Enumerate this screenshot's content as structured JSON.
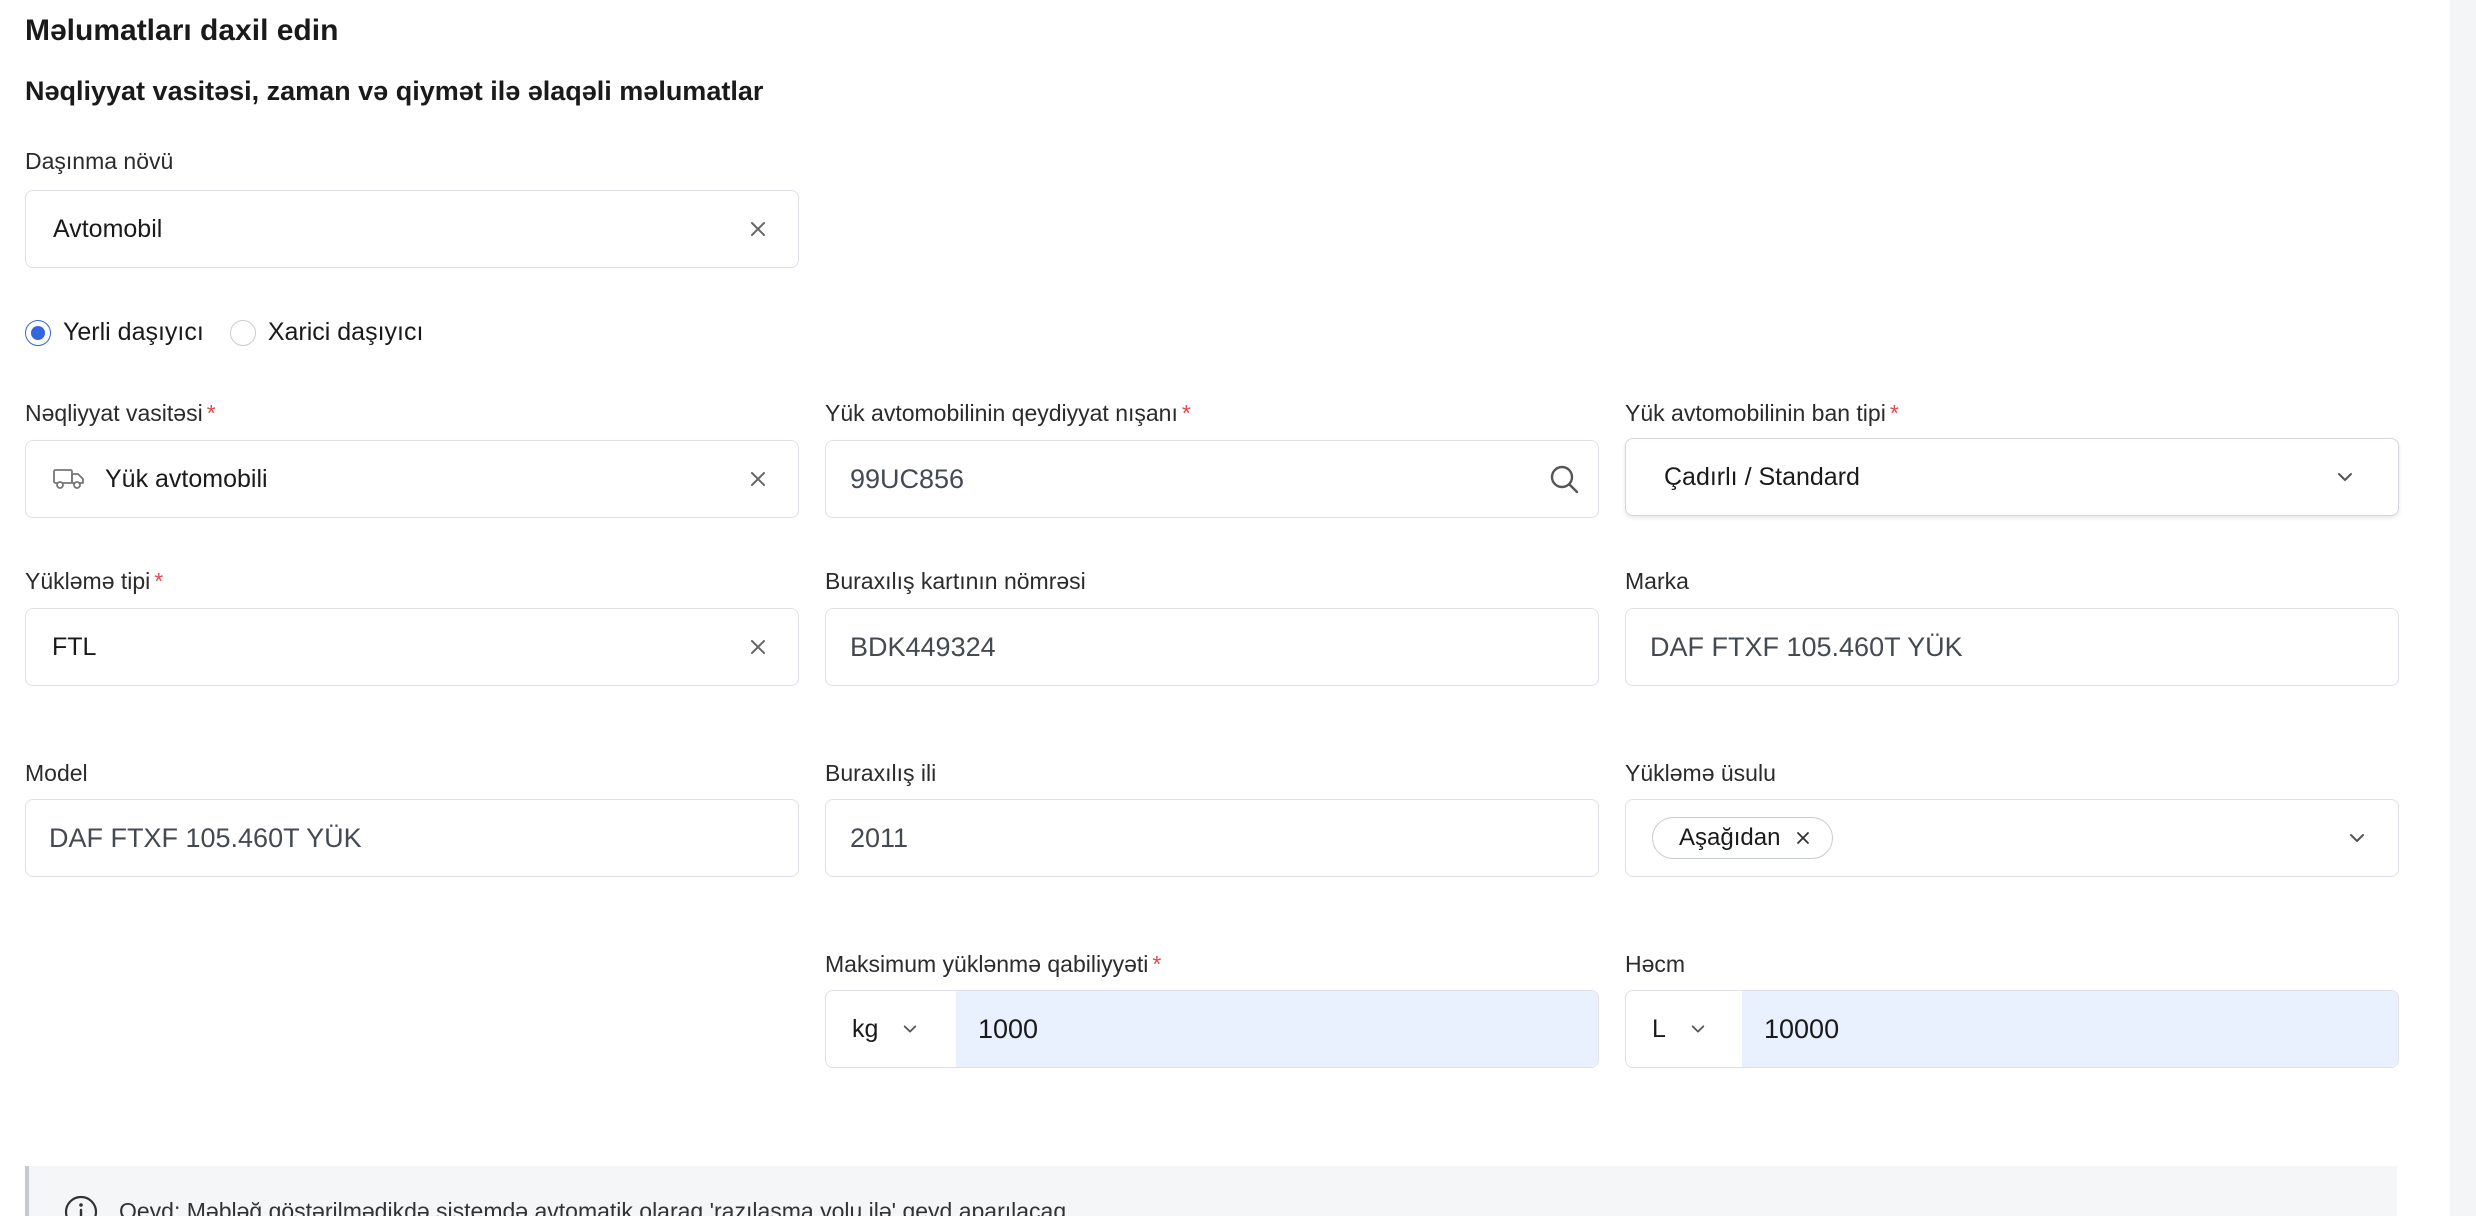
{
  "page": {
    "title": "Məlumatları daxil edin",
    "section_title": "Nəqliyyat vasitəsi, zaman və qiymət ilə əlaqəli məlumatlar"
  },
  "transport_type": {
    "label": "Daşınma növü",
    "value": "Avtomobil"
  },
  "carrier": {
    "options": [
      {
        "label": "Yerli daşıyıcı",
        "selected": true
      },
      {
        "label": "Xarici daşıyıcı",
        "selected": false
      }
    ]
  },
  "vehicle": {
    "label": "Nəqliyyat vasitəsi",
    "value": "Yük avtomobili",
    "icon": "truck-icon"
  },
  "plate": {
    "label": "Yük avtomobilinin qeydiyyat nışanı",
    "value": "99UC856"
  },
  "body_type": {
    "label": "Yük avtomobilinin ban tipi",
    "value": "Çadırlı / Standard"
  },
  "load_type": {
    "label": "Yükləmə tipi",
    "value": "FTL"
  },
  "pass_card": {
    "label": "Buraxılış kartının nömrəsi",
    "value": "BDK449324"
  },
  "brand": {
    "label": "Marka",
    "value": "DAF FTXF 105.460T YÜK"
  },
  "model": {
    "label": "Model",
    "value": "DAF FTXF 105.460T YÜK"
  },
  "year": {
    "label": "Buraxılış ili",
    "value": "2011"
  },
  "load_method": {
    "label": "Yükləmə üsulu",
    "chips": [
      "Aşağıdan"
    ]
  },
  "max_capacity": {
    "label": "Maksimum yüklənmə qabiliyyəti",
    "unit": "kg",
    "value": "1000"
  },
  "volume": {
    "label": "Həcm",
    "unit": "L",
    "value": "10000"
  },
  "note": {
    "text": "Qeyd: Məbləğ göstərilmədikdə sistemdə avtomatik olaraq 'razılaşma yolu ilə' qeyd aparılacaq"
  },
  "colors": {
    "accent": "#3366e0",
    "required": "#e5484d",
    "input_highlight": "#e9f1fe"
  }
}
